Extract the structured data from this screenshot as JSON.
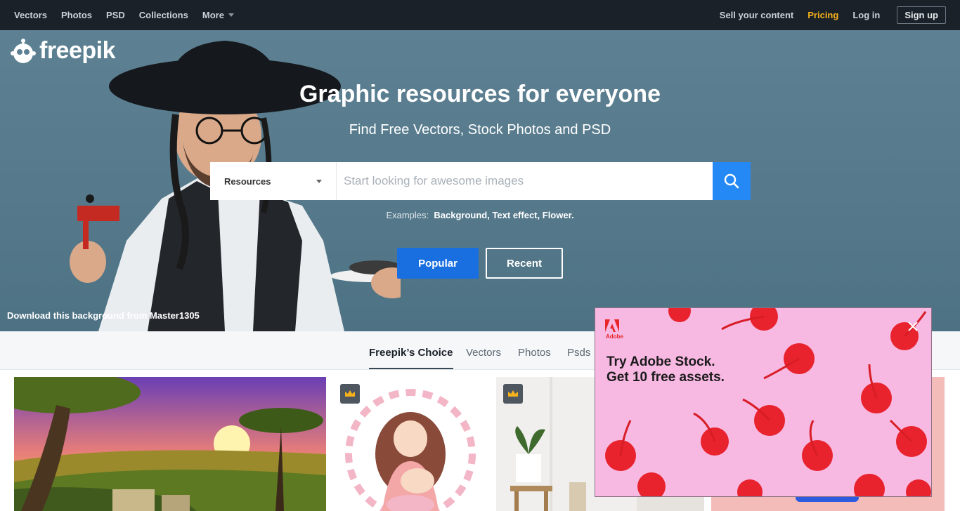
{
  "nav": {
    "left": [
      "Vectors",
      "Photos",
      "PSD",
      "Collections"
    ],
    "more_label": "More",
    "sell": "Sell your content",
    "pricing": "Pricing",
    "login": "Log in",
    "signup": "Sign up"
  },
  "logo": {
    "text": "freepik"
  },
  "hero": {
    "title": "Graphic resources for everyone",
    "subtitle": "Find Free Vectors, Stock Photos and PSD",
    "search": {
      "category": "Resources",
      "placeholder": "Start looking for awesome images"
    },
    "examples_label": "Examples:",
    "examples": [
      "Background",
      "Text effect",
      "Flower"
    ],
    "btn_popular": "Popular",
    "btn_recent": "Recent",
    "credit": "Download this background from Master1305"
  },
  "tabs": [
    "Freepik’s Choice",
    "Vectors",
    "Photos",
    "Psds"
  ],
  "ad": {
    "brand": "Adobe",
    "line1": "Try Adobe Stock.",
    "line2": "Get 10 free assets."
  },
  "colors": {
    "nav_bg": "#1b2128",
    "pricing": "#f7b21b",
    "search_btn": "#2489f5",
    "popular_btn": "#1a6fe0",
    "ad_bg": "#f7b8e2"
  }
}
